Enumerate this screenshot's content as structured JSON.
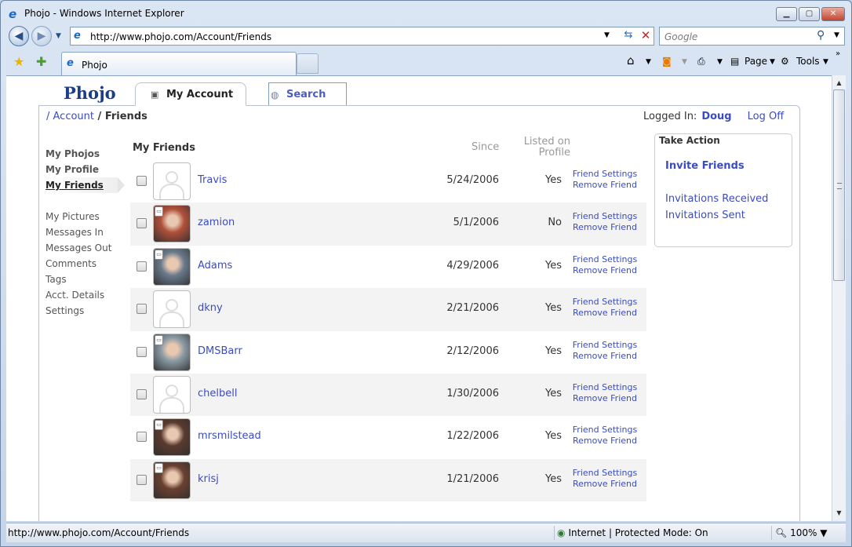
{
  "window": {
    "title": "Phojo - Windows Internet Explorer"
  },
  "address_bar": {
    "url": "http://www.phojo.com/Account/Friends"
  },
  "search_box": {
    "placeholder": "Google"
  },
  "tab": {
    "label": "Phojo"
  },
  "command_bar": {
    "page_label": "Page",
    "tools_label": "Tools"
  },
  "site": {
    "logo": "Phojo",
    "tabs": [
      {
        "label": "My Account"
      },
      {
        "label": "Search"
      }
    ],
    "breadcrumb": {
      "root": "/ Account",
      "sep": "/",
      "current": "Friends"
    },
    "login": {
      "label": "Logged In:",
      "user": "Doug",
      "logoff": "Log Off"
    }
  },
  "left_nav": {
    "primary": [
      "My Phojos",
      "My Profile",
      "My Friends"
    ],
    "secondary": [
      "My Pictures",
      "Messages In",
      "Messages Out",
      "Comments",
      "Tags",
      "Acct. Details",
      "Settings"
    ]
  },
  "friends": {
    "heading": "My Friends",
    "col_since": "Since",
    "col_listed": "Listed on Profile",
    "friend_settings": "Friend Settings",
    "remove_friend": "Remove Friend",
    "rows": [
      {
        "name": "Travis",
        "since": "5/24/2006",
        "listed": "Yes",
        "avatar": "default"
      },
      {
        "name": "zamion",
        "since": "5/1/2006",
        "listed": "No",
        "avatar": "photo",
        "color": "#b0503a"
      },
      {
        "name": "Adams",
        "since": "4/29/2006",
        "listed": "Yes",
        "avatar": "photo",
        "color": "#6a7a8c"
      },
      {
        "name": "dkny",
        "since": "2/21/2006",
        "listed": "Yes",
        "avatar": "default"
      },
      {
        "name": "DMSBarr",
        "since": "2/12/2006",
        "listed": "Yes",
        "avatar": "photo",
        "color": "#8a9aa4"
      },
      {
        "name": "chelbell",
        "since": "1/30/2006",
        "listed": "Yes",
        "avatar": "default"
      },
      {
        "name": "mrsmilstead",
        "since": "1/22/2006",
        "listed": "Yes",
        "avatar": "photo",
        "color": "#5a3a2e"
      },
      {
        "name": "krisj",
        "since": "1/21/2006",
        "listed": "Yes",
        "avatar": "photo",
        "color": "#6a4030"
      }
    ]
  },
  "take_action": {
    "heading": "Take Action",
    "invite": "Invite Friends",
    "received": "Invitations Received",
    "sent": "Invitations Sent"
  },
  "status_bar": {
    "url": "http://www.phojo.com/Account/Friends",
    "zone": "Internet | Protected Mode: On",
    "zoom": "100%"
  }
}
